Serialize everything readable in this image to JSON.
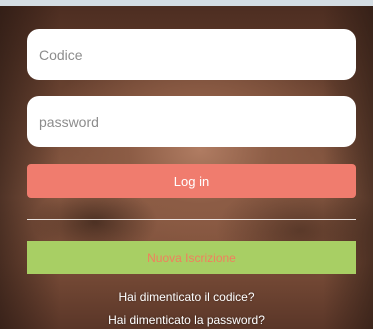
{
  "login_form": {
    "code_placeholder": "Codice",
    "password_placeholder": "password",
    "login_label": "Log in",
    "register_label": "Nuova Iscrizione",
    "forgot_code_label": "Hai dimenticato il codice?",
    "forgot_password_label": "Hai dimenticato la password?"
  },
  "colors": {
    "login_button": "#f07c6e",
    "register_button": "#a8cf64",
    "register_text": "#f17f5e"
  }
}
